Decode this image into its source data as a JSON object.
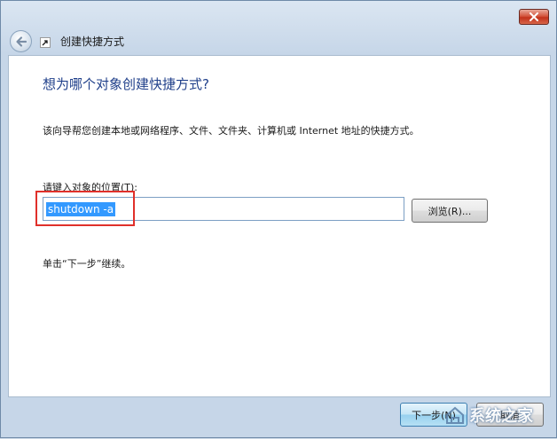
{
  "window": {
    "title": "创建快捷方式"
  },
  "icons": {
    "back": "back-arrow-icon",
    "shortcut": "shortcut-icon",
    "close": "close-icon"
  },
  "content": {
    "heading": "想为哪个对象创建快捷方式?",
    "description": "该向导帮您创建本地或网络程序、文件、文件夹、计算机或 Internet 地址的快捷方式。",
    "location_label": "请键入对象的位置(T):",
    "location_value": "shutdown -a",
    "browse_label": "浏览(R)...",
    "hint": "单击“下一步”继续。"
  },
  "footer": {
    "next_label": "下一步(N)",
    "cancel_label": "取消"
  },
  "watermark": {
    "text": "系统之家"
  },
  "colors": {
    "heading": "#1f3f8a",
    "selection": "#3399ff",
    "highlight_box": "#e0302a",
    "close_button": "#c2321c"
  }
}
